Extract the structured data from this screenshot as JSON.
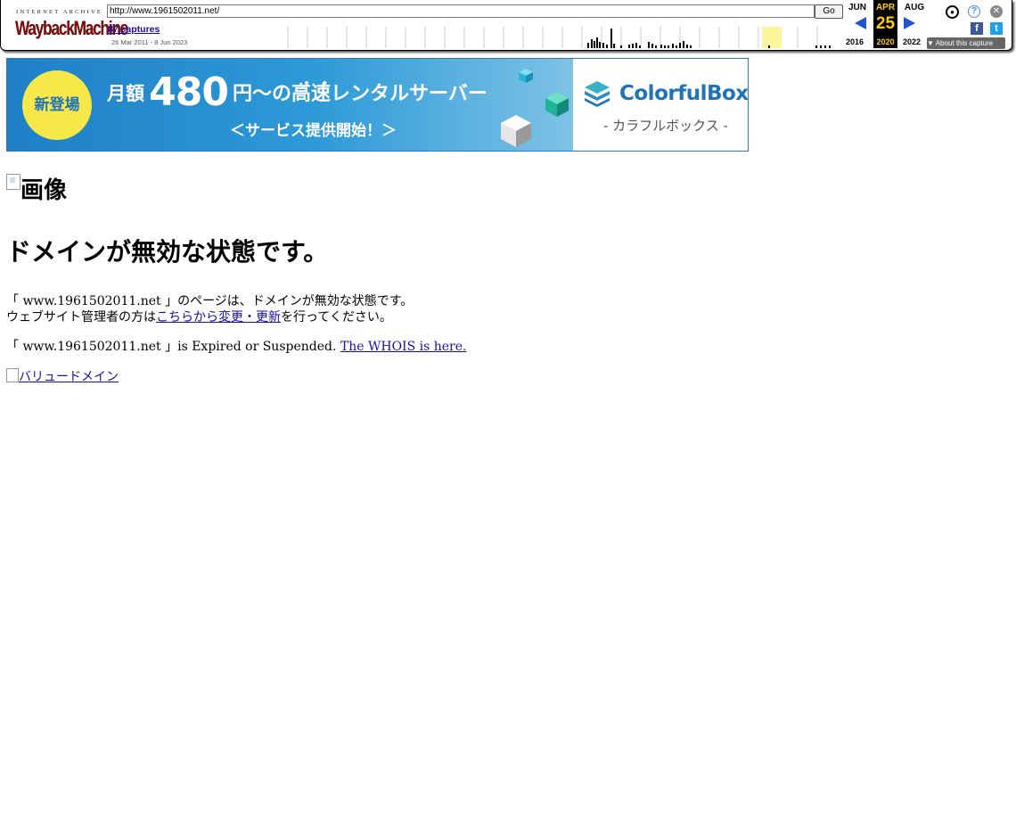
{
  "wayback": {
    "logo_top": "INTERNET ARCHIVE",
    "logo_main": "WaybackMachine",
    "url": "http://www.1961502011.net/",
    "go_label": "Go",
    "captures": "87 captures",
    "range": "26 Mar 2011 - 8 Jun 2023",
    "prev_month": "JUN",
    "current_month": "APR",
    "next_month": "AUG",
    "current_day": "25",
    "prev_year": "2016",
    "current_year": "2020",
    "next_year": "2022",
    "about_label": "▼ About this capture",
    "colors": {
      "accent": "#ffcc00",
      "arrow": "#2255cc"
    }
  },
  "banner": {
    "badge": "新登場",
    "price_pre": "月額",
    "price_num": "480",
    "price_post": "円～の高速レンタルサーバー",
    "sub": "＜サービス提供開始！＞",
    "brand": "ColorfulBox",
    "brand_kana": "- カラフルボックス -"
  },
  "content": {
    "image_alt": "画像",
    "title": "ドメインが無効な状態です。",
    "para1_line1": "「 www.1961502011.net 」のページは、ドメインが無効な状態です。",
    "para1_line2_pre": "ウェブサイト管理者の方は",
    "para1_link": "こちらから変更・更新",
    "para1_line2_post": "を行ってください。",
    "para2_pre": "「 www.1961502011.net 」is Expired or Suspended. ",
    "para2_link": "The WHOIS is here.",
    "para3_link": "バリュードメイン"
  }
}
